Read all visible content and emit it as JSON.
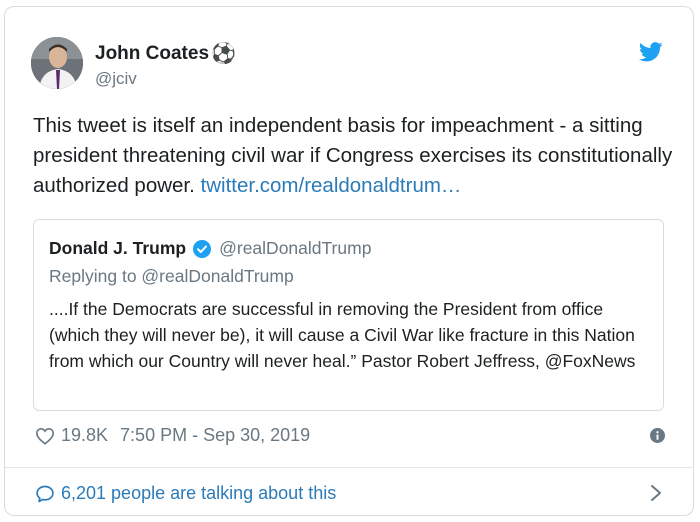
{
  "author": {
    "name": "John Coates",
    "emoji": "⚽",
    "handle": "@jciv"
  },
  "tweet": {
    "text": "This tweet is itself an independent basis for impeachment - a sitting president threatening civil war if Congress exercises its constitutionally authorized power.",
    "link": "twitter.com/realdonaldtrum…"
  },
  "quoted_tweet": {
    "name": "Donald J. Trump",
    "handle": "@realDonaldTrump",
    "reply_line": "Replying to @realDonaldTrump",
    "text": "....If the Democrats are successful in removing the President from office (which they will never be), it will cause a Civil War like fracture in this Nation from which our Country will never heal.” Pastor Robert Jeffress, @FoxNews"
  },
  "meta": {
    "likes": "19.8K",
    "timestamp": "7:50 PM - Sep 30, 2019"
  },
  "footer": {
    "talking": "6,201 people are talking about this"
  },
  "colors": {
    "link": "#2b7bb9",
    "twitter_blue": "#1da1f2",
    "muted": "#697882",
    "border": "#d6dde2"
  },
  "icons": [
    "twitter-bird-icon",
    "verified-badge-icon",
    "heart-icon",
    "info-icon",
    "speech-bubble-icon",
    "chevron-right-icon"
  ]
}
